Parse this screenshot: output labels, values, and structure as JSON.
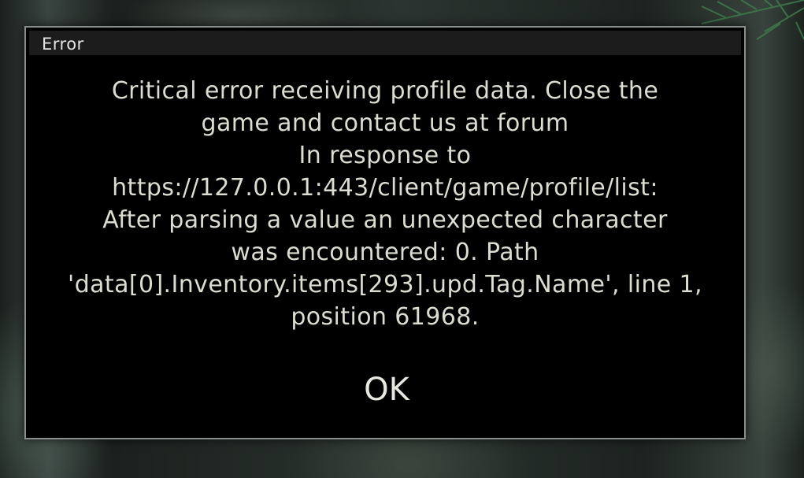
{
  "dialog": {
    "title": "Error",
    "message_lines": [
      "Critical error receiving profile data. Close the",
      "game and contact us at forum",
      "In response to",
      "https://127.0.0.1:443/client/game/profile/list:",
      "After parsing a value an unexpected character",
      "was encountered: 0. Path",
      "'data[0].Inventory.items[293].upd.Tag.Name', line 1,",
      "position 61968."
    ],
    "ok_label": "OK"
  }
}
